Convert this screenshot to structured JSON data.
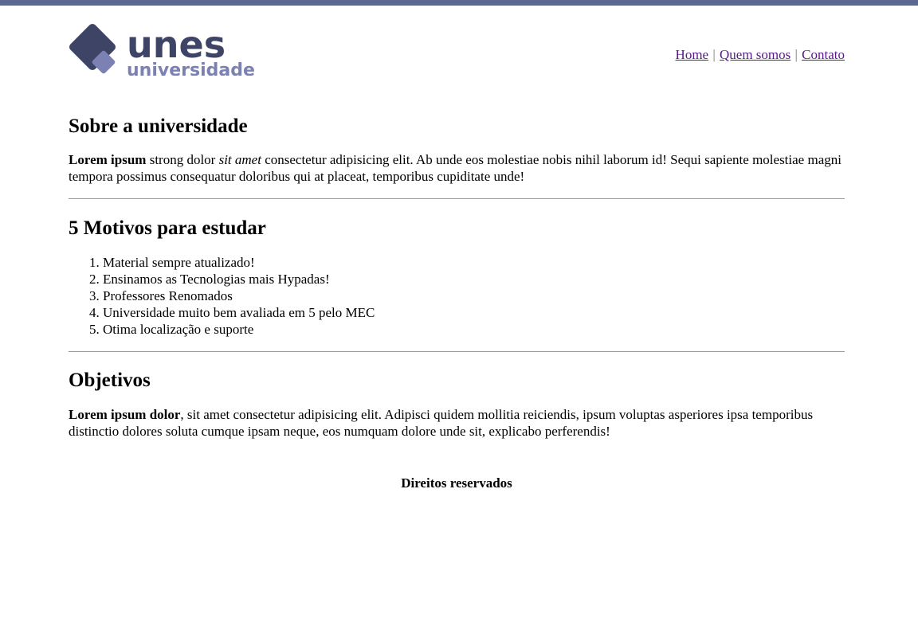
{
  "header": {
    "logo": {
      "primary_text": "unes",
      "secondary_text": "universidade",
      "colors": {
        "dark": "#3d4466",
        "light": "#7b82b3"
      }
    },
    "nav": {
      "items": [
        {
          "label": "Home"
        },
        {
          "label": "Quem somos"
        },
        {
          "label": "Contato"
        }
      ],
      "separator": "|"
    }
  },
  "sections": {
    "about": {
      "title": "Sobre a universidade",
      "text_bold": "Lorem ipsum",
      "text_part1": " strong dolor ",
      "text_italic": "sit amet",
      "text_part2": " consectetur adipisicing elit. Ab unde eos molestiae nobis nihil laborum id! Sequi sapiente molestiae magni tempora possimus consequatur doloribus qui at placeat, temporibus cupiditate unde!"
    },
    "reasons": {
      "title": "5 Motivos para estudar",
      "items": [
        "Material sempre atualizado!",
        "Ensinamos as Tecnologias mais Hypadas!",
        "Professores Renomados",
        "Universidade muito bem avaliada em 5 pelo MEC",
        "Otima localização e suporte"
      ]
    },
    "goals": {
      "title": "Objetivos",
      "text_bold": "Lorem ipsum dolor",
      "text_rest": ", sit amet consectetur adipisicing elit. Adipisci quidem mollitia reiciendis, ipsum voluptas asperiores ipsa temporibus distinctio dolores soluta cumque ipsam neque, eos numquam dolore unde sit, explicabo perferendis!"
    }
  },
  "footer": {
    "text": "Direitos reservados"
  },
  "colors": {
    "top_bar": "#5d6791",
    "link": "#551a8b",
    "separator": "#777777",
    "rule": "#9a9a9a"
  }
}
